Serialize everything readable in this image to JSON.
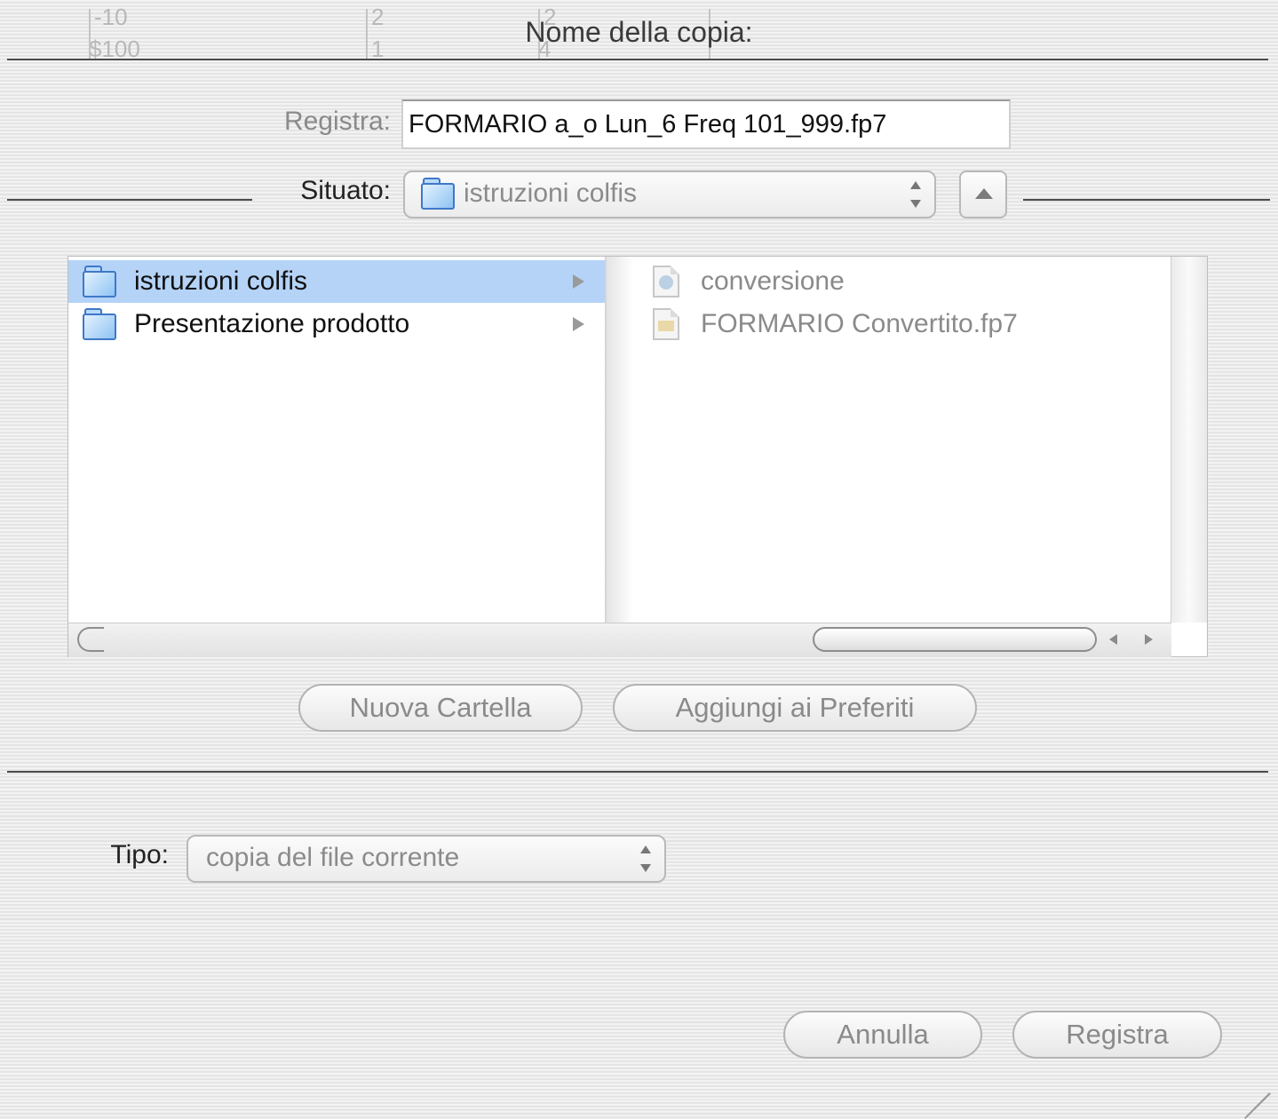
{
  "background_text": {
    "ruler_a1": "-10",
    "ruler_a2": "$100",
    "ruler_b1": "2",
    "ruler_b2": "1",
    "ruler_c1": "2",
    "ruler_c2": "4"
  },
  "dialog": {
    "title": "Nome della copia:",
    "save_label": "Registra:",
    "save_value": "FORMARIO a_o Lun_6 Freq 101_999.fp7",
    "location_label": "Situato:",
    "location_value": "istruzioni colfis"
  },
  "browser": {
    "column1": [
      {
        "label": "istruzioni colfis",
        "selected": true
      },
      {
        "label": "Presentazione prodotto",
        "selected": false
      }
    ],
    "column2": [
      {
        "label": "conversione",
        "icon": "alias-icon"
      },
      {
        "label": "FORMARIO Convertito.fp7",
        "icon": "document-icon"
      }
    ]
  },
  "buttons": {
    "new_folder": "Nuova Cartella",
    "add_favorites": "Aggiungi ai Preferiti",
    "cancel": "Annulla",
    "save": "Registra"
  },
  "type": {
    "label": "Tipo:",
    "value": "copia del file corrente"
  },
  "colors": {
    "selection": "#b5d3f7",
    "folder_blue": "#3f78c8"
  }
}
